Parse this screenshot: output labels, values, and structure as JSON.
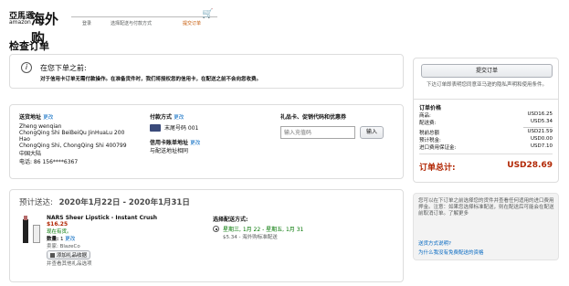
{
  "header": {
    "logo_top": "亞馬遜",
    "logo_bottom": "amazon",
    "logo_text": "海外购",
    "steps": [
      "登录",
      "选择配送与付款方式",
      "提交订单"
    ]
  },
  "page_title": "检查订单",
  "notice": {
    "title": "在您下单之前:",
    "text": "对于信用卡订单无需付款操作。在准备货件时，我们将授权您的信用卡，在配送之前不会向您收费。"
  },
  "shipping": {
    "label": "送货地址",
    "change": "更改",
    "lines": [
      "Zheng wenqian",
      "ChongQing Shi BeiBeiQu JinHuaLu 200",
      "Hao",
      "ChongQing Shi, ChongQing Shi 400799",
      "中国大陆"
    ],
    "phone": "电话: 86 156****6367"
  },
  "payment": {
    "label": "付款方式",
    "change": "更改",
    "card": "末尾号码 001",
    "billing_label": "信用卡账单地址",
    "billing_change": "更改",
    "billing_value": "与配送地址相同"
  },
  "giftcard": {
    "label": "礼品卡、促销代码和优惠券",
    "placeholder": "输入充值码",
    "button": "输入"
  },
  "delivery": {
    "title": "预计送达:",
    "range": "2020年1月22日 - 2020年1月31日",
    "product": {
      "name": "NARS Sheer Lipstick - Instant Crush",
      "price": "$16.25",
      "stock": "现在有货。",
      "qty_label": "数量:",
      "qty": "1",
      "qty_change": "更改",
      "seller": "卖家:",
      "seller_name": "BlazeCo",
      "gift_button": "添加礼品收据",
      "gift_note": "并查看其他礼品选项"
    },
    "options_label": "选择配送方式:",
    "option_line1": "星期三, 1月 22 - 星期五, 1月 31",
    "option_line2": "$5.34 - 海外购标准配送"
  },
  "summary": {
    "button": "提交订单",
    "agree_text": "下达订单即表明您同意亚马逊的隐私声明和使用条件。",
    "title": "订单价格",
    "rows": [
      {
        "label": "商品:",
        "value": "USD16.25"
      },
      {
        "label": "配送费:",
        "value": "USD5.34"
      },
      {
        "label": "税前总额",
        "value": "USD21.59"
      },
      {
        "label": "预计税金:",
        "value": "USD0.00"
      },
      {
        "label": "进口费用保证金:",
        "value": "USD7.10"
      }
    ],
    "total_label": "订单总计:",
    "total_value": "USD28.69",
    "footer_text": "您可以在下订单之前选择您的货件并查看任何适用的进口费用押金。注意：如果您选择标准配送，则在配送后可能会在配送前取消订单。了解更多",
    "link1": "送货方式说明?",
    "link2": "为什么我没有免费配送的资格"
  },
  "colors": {
    "accent_orange": "#c45500",
    "link_blue": "#0066c0",
    "price_red": "#b12704"
  }
}
